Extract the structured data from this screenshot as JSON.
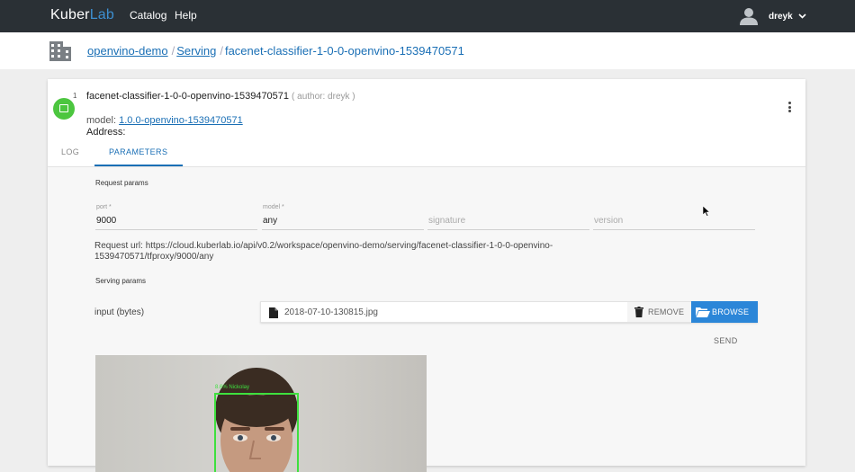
{
  "app": {
    "brand_main": "Kuber",
    "brand_accent": "Lab",
    "accent_color": "#3d8fd1"
  },
  "topnav": {
    "items": [
      "Catalog",
      "Help"
    ],
    "user": "dreyk"
  },
  "breadcrumb": {
    "items": [
      "openvino-demo",
      "Serving",
      "facenet-classifier-1-0-0-openvino-1539470571"
    ],
    "separator": "/"
  },
  "serving": {
    "status_count": "1",
    "status_color": "#4cc63f",
    "name": "facenet-classifier-1-0-0-openvino-1539470571",
    "author": "( author: dreyk )",
    "model_label": "model:",
    "model_link": "1.0.0-openvino-1539470571",
    "address_label": "Address:"
  },
  "tabs": {
    "log": "LOG",
    "parameters": "PARAMETERS",
    "active": "PARAMETERS"
  },
  "request_params": {
    "title": "Request params",
    "port": {
      "label": "port *",
      "value": "9000"
    },
    "model": {
      "label": "model *",
      "value": "any"
    },
    "signature": {
      "placeholder": "signature",
      "value": ""
    },
    "version": {
      "placeholder": "version",
      "value": ""
    },
    "request_url": "Request url: https://cloud.kuberlab.io/api/v0.2/workspace/openvino-demo/serving/facenet-classifier-1-0-0-openvino-1539470571/tfproxy/9000/any"
  },
  "serving_params": {
    "title": "Serving params",
    "input_label": "input (bytes)",
    "file_name": "2018-07-10-130815.jpg",
    "remove_label": "REMOVE",
    "browse_label": "BROWSE",
    "send_label": "SEND"
  },
  "result": {
    "face_label": "8.6% Nickolay",
    "box_color": "#3ee03e"
  }
}
